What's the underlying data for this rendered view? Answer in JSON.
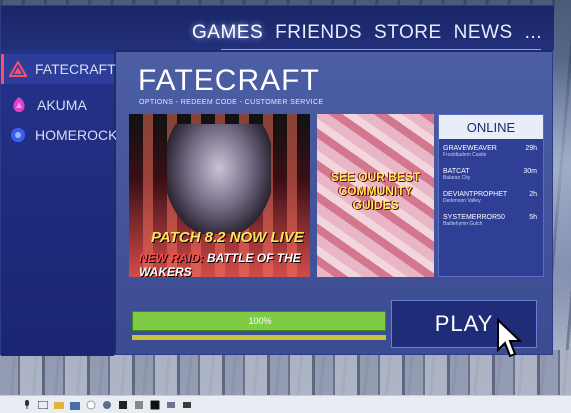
{
  "colors": {
    "accent": "#ff4d6d",
    "app_bg": "#1c2a6e",
    "progress_green": "#7fcc44",
    "progress_yellow": "#c7c43b"
  },
  "topnav": {
    "items": [
      {
        "label": "GAMES",
        "active": true
      },
      {
        "label": "FRIENDS"
      },
      {
        "label": "STORE"
      },
      {
        "label": "NEWS"
      },
      {
        "label": "..."
      }
    ]
  },
  "sidebar": {
    "items": [
      {
        "label": "FATECRAFT",
        "icon": "fatecraft-logo-icon",
        "active": true
      },
      {
        "label": "AKUMA",
        "icon": "akuma-logo-icon"
      },
      {
        "label": "HOMEROCK",
        "icon": "homerock-logo-icon"
      }
    ]
  },
  "main": {
    "title": "FATECRAFT",
    "subtitle": "OPTIONS - REDEEM CODE - CUSTOMER SERVICE",
    "banner1": {
      "headline": "PATCH 8.2 NOW LIVE",
      "sub_prefix": "NEW RAID:",
      "sub_text": " BATTLE OF THE WAKERS"
    },
    "banner2": {
      "text": "SEE OUR BEST COMMUNITY GUIDES"
    },
    "online": {
      "header": "ONLINE",
      "friends": [
        {
          "name": "GRAVEWEAVER",
          "location": "Frostdiadem Castle",
          "time": "29h"
        },
        {
          "name": "BATCAT",
          "location": "Balaran City",
          "time": "30m"
        },
        {
          "name": "DEVIANTPROPHET",
          "location": "Derkmoon Valley",
          "time": "2h"
        },
        {
          "name": "SYSTEMERROR50",
          "location": "Battlehymn Gulch",
          "time": "5h"
        }
      ]
    },
    "progress": {
      "label": "100%",
      "value": 1.0
    },
    "play_label": "PLAY"
  },
  "taskbar": {
    "icons": [
      "windows-icon",
      "microphone-icon",
      "file-explorer-icon",
      "store-icon",
      "circle-icon",
      "edge-icon",
      "settings-icon",
      "app-icon",
      "photos-icon",
      "tablet-icon"
    ]
  }
}
